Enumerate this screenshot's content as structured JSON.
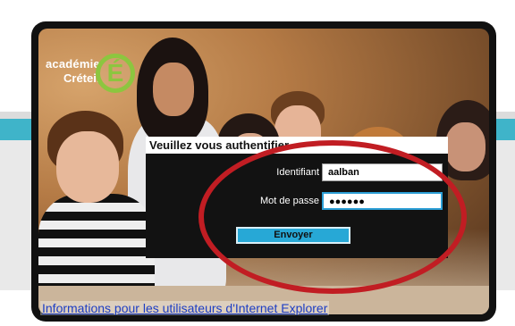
{
  "logo": {
    "line1": "académie",
    "line2": "Créteil",
    "mark": "É"
  },
  "login": {
    "title": "Veuillez vous authentifier",
    "identifiant_label": "Identifiant",
    "identifiant_value": "aalban",
    "password_label": "Mot de passe",
    "password_value": "●●●●●●",
    "submit_label": "Envoyer"
  },
  "footer": {
    "ie_link": "Informations pour les utilisateurs d'Internet Explorer"
  },
  "colors": {
    "highlight": "#c11d23",
    "accent_blue": "#27a8d6",
    "logo_green": "#8cc63f"
  }
}
